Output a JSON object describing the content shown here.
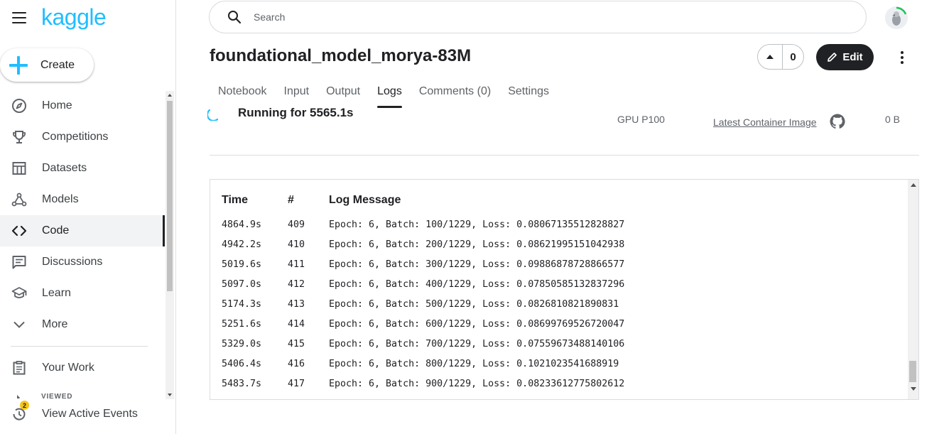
{
  "brand": {
    "logo": "kaggle",
    "accent": "#20beff"
  },
  "sidebar": {
    "create_label": "Create",
    "items": [
      {
        "label": "Home",
        "icon": "compass-icon"
      },
      {
        "label": "Competitions",
        "icon": "trophy-icon"
      },
      {
        "label": "Datasets",
        "icon": "table-icon"
      },
      {
        "label": "Models",
        "icon": "models-icon"
      },
      {
        "label": "Code",
        "icon": "code-icon",
        "active": true
      },
      {
        "label": "Discussions",
        "icon": "discussion-icon"
      },
      {
        "label": "Learn",
        "icon": "school-icon"
      },
      {
        "label": "More",
        "icon": "chevron-down-icon"
      }
    ],
    "your_work": "Your Work",
    "viewed_label": "VIEWED",
    "events_label": "View Active Events",
    "events_badge": "2"
  },
  "search": {
    "placeholder": "Search"
  },
  "notebook": {
    "title": "foundational_model_morya-83M",
    "votes": "0",
    "edit_label": "Edit"
  },
  "tabs": [
    {
      "label": "Notebook"
    },
    {
      "label": "Input"
    },
    {
      "label": "Output"
    },
    {
      "label": "Logs",
      "active": true
    },
    {
      "label": "Comments (0)"
    },
    {
      "label": "Settings"
    }
  ],
  "status": {
    "running": "Running for 5565.1s",
    "accelerator": "GPU P100",
    "container": "Latest Container Image",
    "size": "0 B"
  },
  "logs": {
    "headers": {
      "time": "Time",
      "num": "#",
      "message": "Log Message"
    },
    "rows": [
      {
        "time": "4864.9s",
        "num": "409",
        "message": "Epoch: 6, Batch: 100/1229, Loss: 0.08067135512828827"
      },
      {
        "time": "4942.2s",
        "num": "410",
        "message": "Epoch: 6, Batch: 200/1229, Loss: 0.08621995151042938"
      },
      {
        "time": "5019.6s",
        "num": "411",
        "message": "Epoch: 6, Batch: 300/1229, Loss: 0.09886878728866577"
      },
      {
        "time": "5097.0s",
        "num": "412",
        "message": "Epoch: 6, Batch: 400/1229, Loss: 0.07850585132837296"
      },
      {
        "time": "5174.3s",
        "num": "413",
        "message": "Epoch: 6, Batch: 500/1229, Loss: 0.0826810821890831"
      },
      {
        "time": "5251.6s",
        "num": "414",
        "message": "Epoch: 6, Batch: 600/1229, Loss: 0.08699769526720047"
      },
      {
        "time": "5329.0s",
        "num": "415",
        "message": "Epoch: 6, Batch: 700/1229, Loss: 0.07559673488140106"
      },
      {
        "time": "5406.4s",
        "num": "416",
        "message": "Epoch: 6, Batch: 800/1229, Loss: 0.1021023541688919"
      },
      {
        "time": "5483.7s",
        "num": "417",
        "message": "Epoch: 6, Batch: 900/1229, Loss: 0.08233612775802612"
      }
    ]
  }
}
